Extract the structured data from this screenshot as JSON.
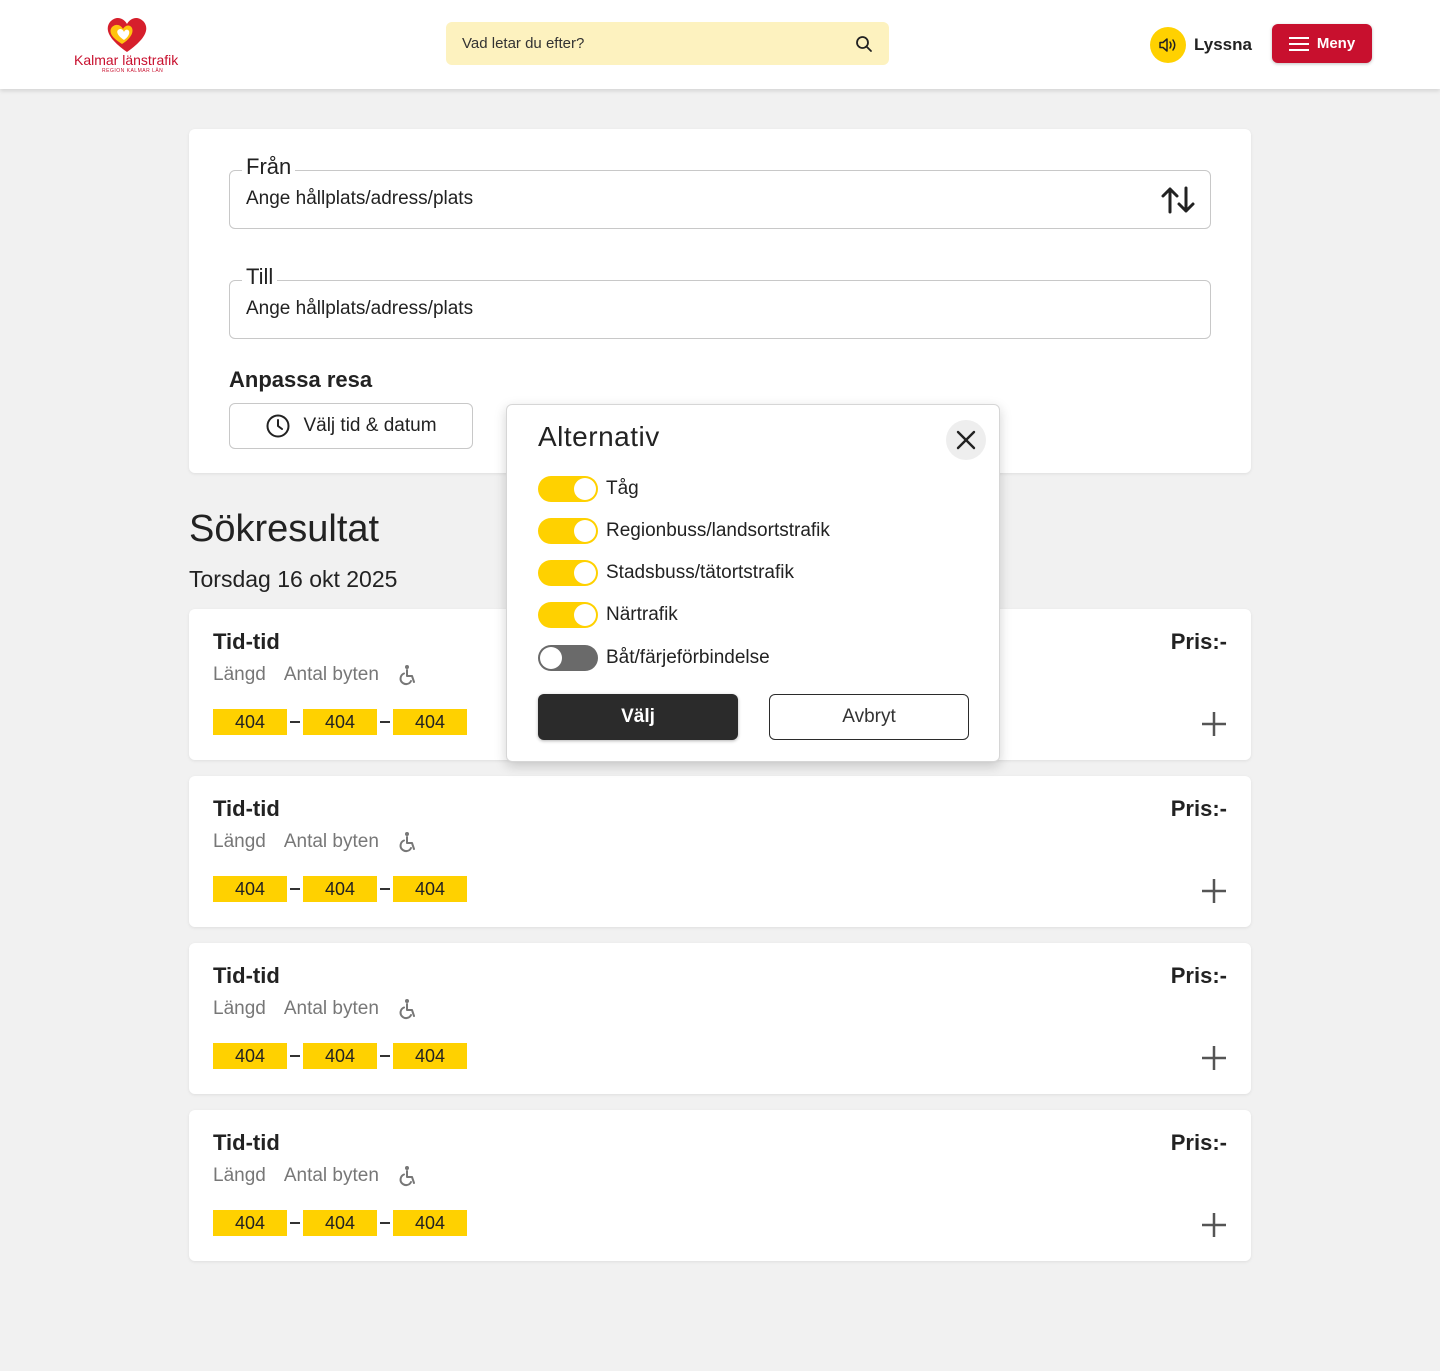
{
  "header": {
    "logo_text": "Kalmar länstrafik",
    "logo_sub": "REGION KALMAR LÄN",
    "search_placeholder": "Vad letar du efter?",
    "listen_label": "Lyssna",
    "menu_label": "Meny",
    "brand_color": "#c8102e",
    "accent_color": "#ffd100"
  },
  "form": {
    "from_label": "Från",
    "from_placeholder": "Ange hållplats/adress/plats",
    "to_label": "Till",
    "to_placeholder": "Ange hållplats/adress/plats",
    "adapt_title": "Anpassa resa",
    "time_button_label": "Välj tid & datum"
  },
  "results": {
    "title": "Sökresultat",
    "date": "Torsdag 16 okt 2025",
    "items": [
      {
        "time": "Tid-tid",
        "price": "Pris:-",
        "length": "Längd",
        "changes": "Antal byten",
        "lines": [
          "404",
          "404",
          "404"
        ]
      },
      {
        "time": "Tid-tid",
        "price": "Pris:-",
        "length": "Längd",
        "changes": "Antal byten",
        "lines": [
          "404",
          "404",
          "404"
        ]
      },
      {
        "time": "Tid-tid",
        "price": "Pris:-",
        "length": "Längd",
        "changes": "Antal byten",
        "lines": [
          "404",
          "404",
          "404"
        ]
      },
      {
        "time": "Tid-tid",
        "price": "Pris:-",
        "length": "Längd",
        "changes": "Antal byten",
        "lines": [
          "404",
          "404",
          "404"
        ]
      }
    ]
  },
  "modal": {
    "title": "Alternativ",
    "options": [
      {
        "label": "Tåg",
        "enabled": true
      },
      {
        "label": "Regionbuss/landsortstrafik",
        "enabled": true
      },
      {
        "label": "Stadsbuss/tätortstrafik",
        "enabled": true
      },
      {
        "label": "Närtrafik",
        "enabled": true
      },
      {
        "label": "Båt/färjeförbindelse",
        "enabled": false
      }
    ],
    "choose_label": "Välj",
    "cancel_label": "Avbryt"
  }
}
